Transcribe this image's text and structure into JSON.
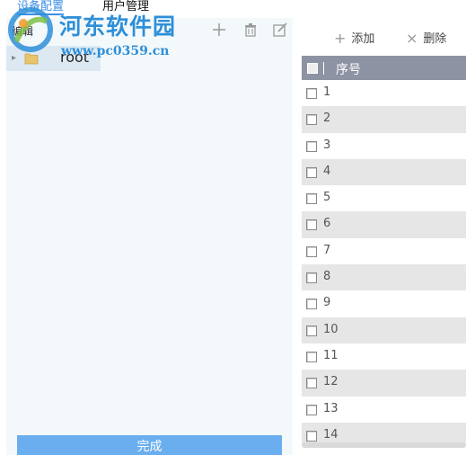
{
  "tabs": [
    {
      "label": "设备配置"
    },
    {
      "label": "用户管理"
    }
  ],
  "left_panel": {
    "title": "编辑",
    "tree": {
      "root_label": "root"
    },
    "done_label": "完成"
  },
  "watermark": {
    "title": "河东软件园",
    "url": "www.pc0359.cn"
  },
  "right_panel": {
    "add_label": "添加",
    "delete_label": "删除",
    "table": {
      "header": "序号",
      "rows": [
        "1",
        "2",
        "3",
        "4",
        "5",
        "6",
        "7",
        "8",
        "9",
        "10",
        "11",
        "12",
        "13",
        "14"
      ]
    }
  },
  "colors": {
    "accent": "#3a8ee6",
    "done_button": "#6aaef0",
    "table_header": "#8d93a2",
    "row_alt": "#e6e6e6",
    "left_panel_bg": "#f3f8fb"
  },
  "icons": [
    "plus-icon",
    "trash-icon",
    "edit-icon",
    "folder-icon",
    "close-icon",
    "checkbox-icon"
  ]
}
